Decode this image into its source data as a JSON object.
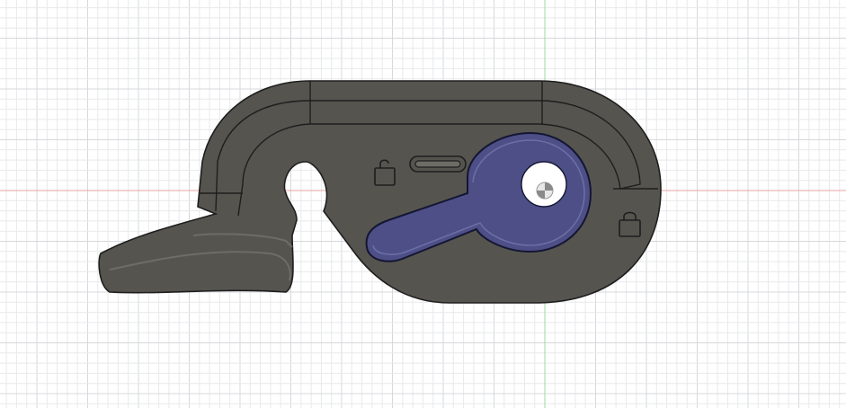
{
  "viewport": {
    "grid_minor_color": "#e8e9eb",
    "grid_major_color": "#d6d8dc",
    "x_axis_color": "#e8a3a3",
    "y_axis_color": "#9fd99f",
    "background_color": "#ffffff"
  },
  "model": {
    "body": {
      "fill_color": "#56544f",
      "edge_color": "#1e1e1e",
      "highlight_color": "#6e6c66"
    },
    "lever": {
      "fill_color": "#4d4f86",
      "edge_color": "#141633",
      "highlight_color": "#6b6ea6"
    },
    "pivot_hole": {
      "fill_color": "#ffffff"
    },
    "icons": {
      "unlocked": "padlock-open-icon",
      "locked": "padlock-closed-icon",
      "slider": "slider-slot-icon",
      "origin": "origin-marker-icon"
    }
  }
}
